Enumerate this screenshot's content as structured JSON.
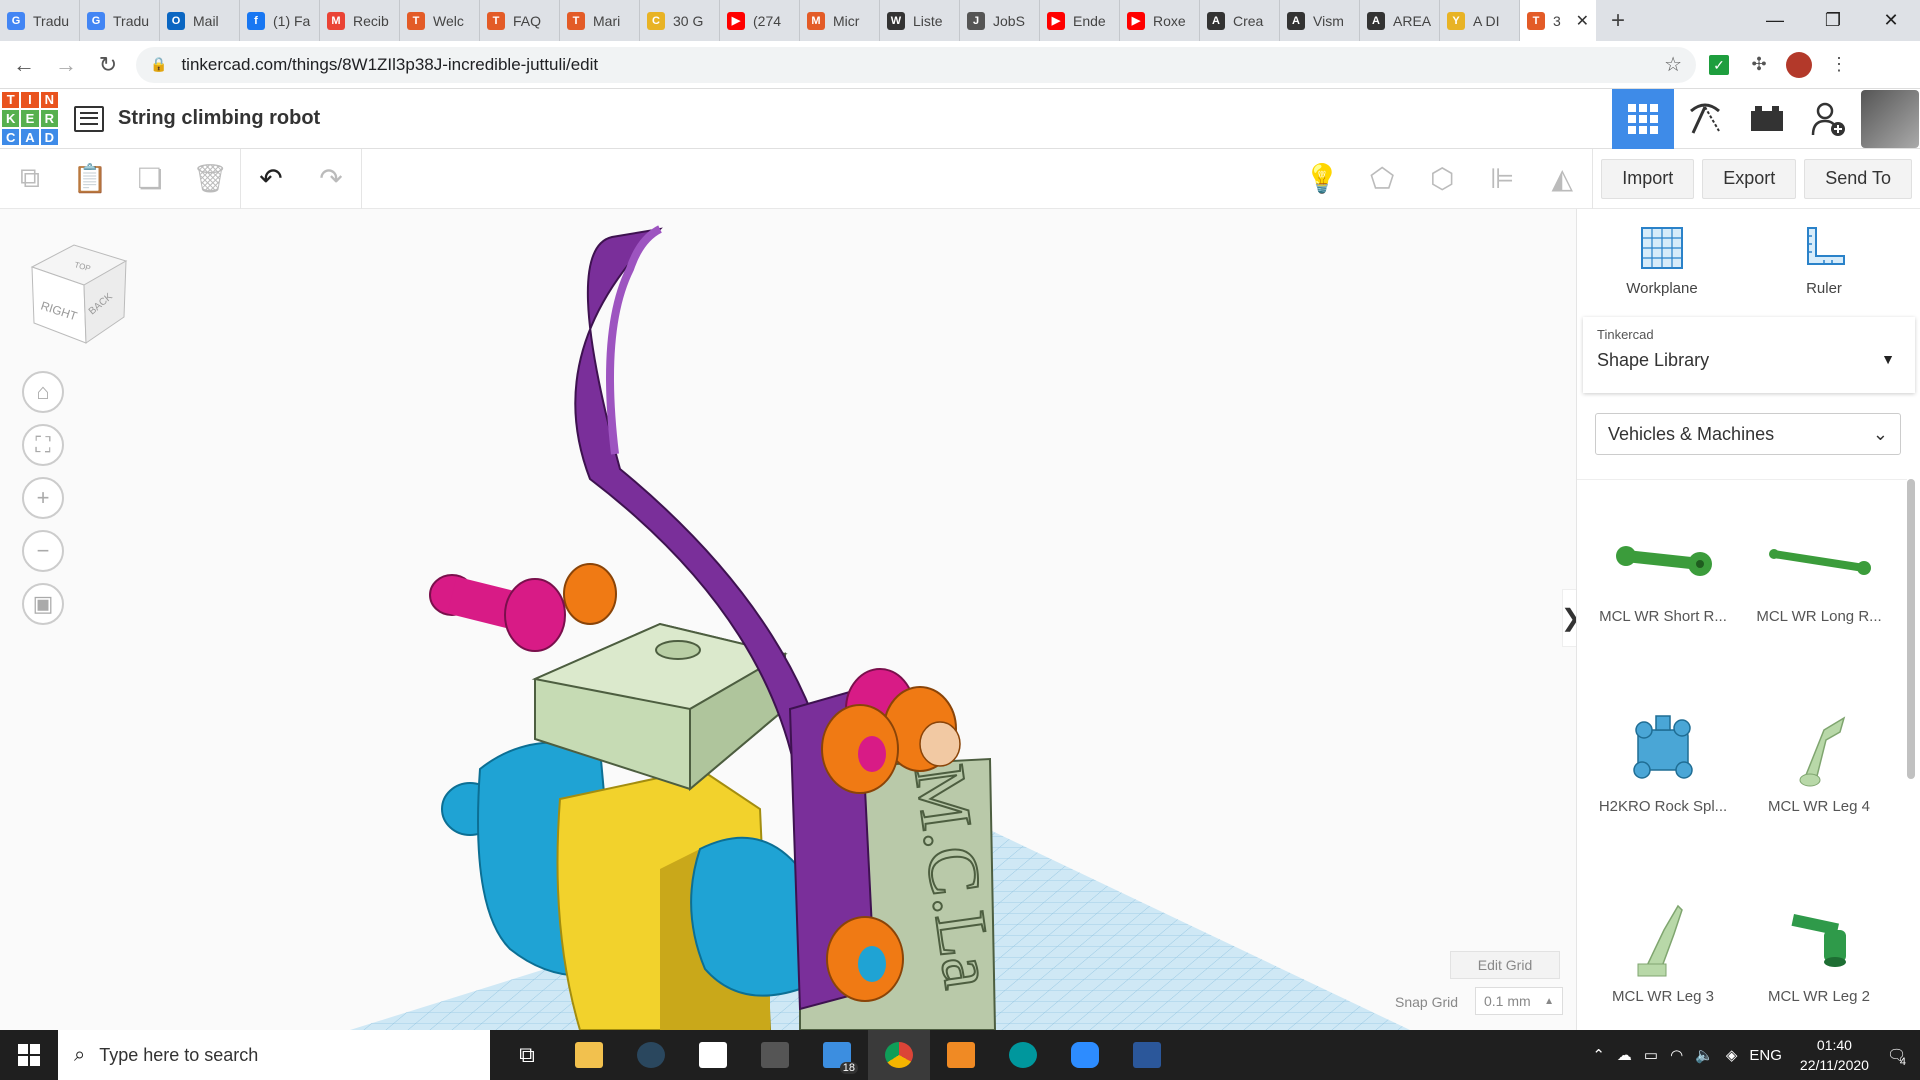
{
  "browser": {
    "tabs": [
      {
        "label": "Tradu",
        "color": "#4285f4",
        "glyph": "G"
      },
      {
        "label": "Tradu",
        "color": "#4285f4",
        "glyph": "G"
      },
      {
        "label": "Mail",
        "color": "#0a66c2",
        "glyph": "O"
      },
      {
        "label": "(1) Fa",
        "color": "#1877f2",
        "glyph": "f"
      },
      {
        "label": "Recib",
        "color": "#ea4335",
        "glyph": "M"
      },
      {
        "label": "Welc",
        "color": "#e35b27",
        "glyph": "T"
      },
      {
        "label": "FAQ",
        "color": "#e35b27",
        "glyph": "T"
      },
      {
        "label": "Mari",
        "color": "#e35b27",
        "glyph": "T"
      },
      {
        "label": "30 G",
        "color": "#e8b325",
        "glyph": "C"
      },
      {
        "label": "(274",
        "color": "#ff0000",
        "glyph": "▶"
      },
      {
        "label": "Micr",
        "color": "#e35b27",
        "glyph": "M"
      },
      {
        "label": "Liste",
        "color": "#333333",
        "glyph": "W"
      },
      {
        "label": "JobS",
        "color": "#555555",
        "glyph": "J"
      },
      {
        "label": "Ende",
        "color": "#ff0000",
        "glyph": "▶"
      },
      {
        "label": "Roxe",
        "color": "#ff0000",
        "glyph": "▶"
      },
      {
        "label": "Crea",
        "color": "#333333",
        "glyph": "A"
      },
      {
        "label": "Vism",
        "color": "#333333",
        "glyph": "A"
      },
      {
        "label": "AREA",
        "color": "#333333",
        "glyph": "A"
      },
      {
        "label": "A DI",
        "color": "#e8b325",
        "glyph": "Y"
      }
    ],
    "active_tab": {
      "label": "3",
      "close": "✕"
    },
    "new_tab": "+",
    "url": "tinkercad.com/things/8W1ZIl3p38J-incredible-juttuli/edit"
  },
  "app": {
    "logo_letters": [
      "T",
      "I",
      "N",
      "K",
      "E",
      "R",
      "C",
      "A",
      "D"
    ],
    "logo_colors": [
      "#e9531e",
      "#e9531e",
      "#e9531e",
      "#57b04f",
      "#57b04f",
      "#57b04f",
      "#3e8be8",
      "#3e8be8",
      "#3e8be8"
    ],
    "design_title": "String climbing robot"
  },
  "toolbar": {
    "import_label": "Import",
    "export_label": "Export",
    "sendto_label": "Send To"
  },
  "workspace": {
    "viewcube": {
      "top": "TOP",
      "right": "RIGHT",
      "back": "BACK"
    },
    "edit_grid_label": "Edit Grid",
    "snap_grid_label": "Snap Grid",
    "snap_grid_value": "0.1 mm",
    "model_text": "M.C.La"
  },
  "panel": {
    "workplane_label": "Workplane",
    "ruler_label": "Ruler",
    "library_provider": "Tinkercad",
    "library_name": "Shape Library",
    "category": "Vehicles & Machines",
    "shapes": [
      {
        "label": "MCL WR Short R...",
        "icon": "short-rod-icon"
      },
      {
        "label": "MCL WR Long R...",
        "icon": "long-rod-icon"
      },
      {
        "label": "H2KRO Rock Spl...",
        "icon": "rock-splitter-icon"
      },
      {
        "label": "MCL WR Leg 4",
        "icon": "leg-4-icon"
      },
      {
        "label": "MCL WR Leg 3",
        "icon": "leg-3-icon"
      },
      {
        "label": "MCL WR Leg 2",
        "icon": "leg-2-icon"
      }
    ]
  },
  "taskbar": {
    "search_placeholder": "Type here to search",
    "mail_badge": "18",
    "language": "ENG",
    "time": "01:40",
    "date": "22/11/2020",
    "notification_count": "4"
  }
}
